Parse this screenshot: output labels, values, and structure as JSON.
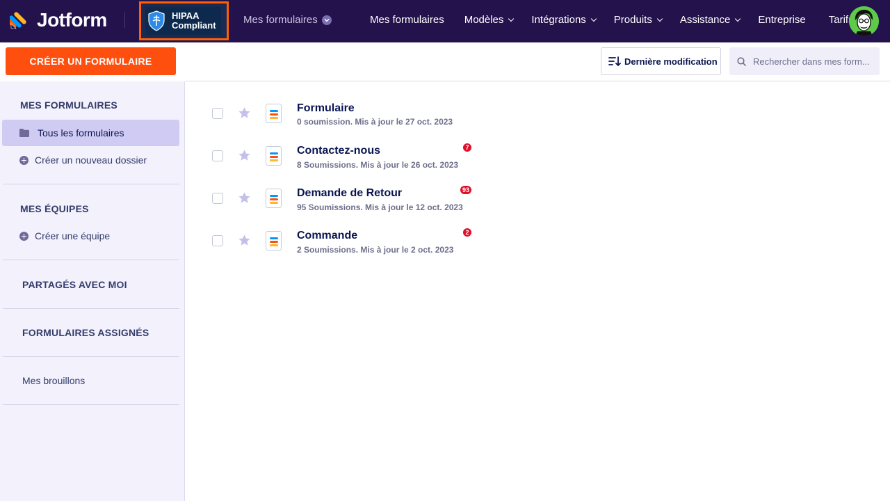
{
  "header": {
    "brand": "Jotform",
    "hipaa_line1": "HIPAA",
    "hipaa_line2": "Compliant",
    "my_forms_dropdown": "Mes formulaires",
    "nav": [
      {
        "label": "Mes formulaires",
        "dropdown": false
      },
      {
        "label": "Modèles",
        "dropdown": true
      },
      {
        "label": "Intégrations",
        "dropdown": true
      },
      {
        "label": "Produits",
        "dropdown": true
      },
      {
        "label": "Assistance",
        "dropdown": true
      },
      {
        "label": "Entreprise",
        "dropdown": false
      },
      {
        "label": "Tarifs",
        "dropdown": false
      }
    ]
  },
  "sidebar": {
    "create_button": "CRÉER UN FORMULAIRE",
    "my_forms_title": "MES FORMULAIRES",
    "all_forms": "Tous les formulaires",
    "new_folder": "Créer un nouveau dossier",
    "my_teams_title": "MES ÉQUIPES",
    "create_team": "Créer une équipe",
    "shared_with_me": "PARTAGÉS AVEC MOI",
    "assigned_forms": "FORMULAIRES ASSIGNÉS",
    "drafts": "Mes brouillons"
  },
  "toolbar": {
    "sort_label": "Dernière modification",
    "search_placeholder": "Rechercher dans mes form..."
  },
  "forms": [
    {
      "title": "Formulaire",
      "subtitle": "0 soumission. Mis à jour le 27 oct. 2023",
      "badge": ""
    },
    {
      "title": "Contactez-nous",
      "subtitle": "8 Soumissions. Mis à jour le 26 oct. 2023",
      "badge": "7"
    },
    {
      "title": "Demande de Retour",
      "subtitle": "95 Soumissions. Mis à jour le 12 oct. 2023",
      "badge": "93"
    },
    {
      "title": "Commande",
      "subtitle": "2 Soumissions. Mis à jour le 2 oct. 2023",
      "badge": "2"
    }
  ],
  "colors": {
    "topbar": "#24124d",
    "accent_orange": "#ff4f0f",
    "sidebar_bg": "#f2f1fc",
    "active_item": "#cfcbf2",
    "badge_red": "#e0102b",
    "star_color": "#c3c0ea"
  },
  "icons": {
    "logo": "jotform-logo-icon",
    "hipaa": "hipaa-shield-icon",
    "folder": "folder-icon",
    "plus": "plus-circle-icon",
    "sort": "sort-icon",
    "search": "search-icon",
    "star": "star-icon",
    "form": "form-icon"
  }
}
